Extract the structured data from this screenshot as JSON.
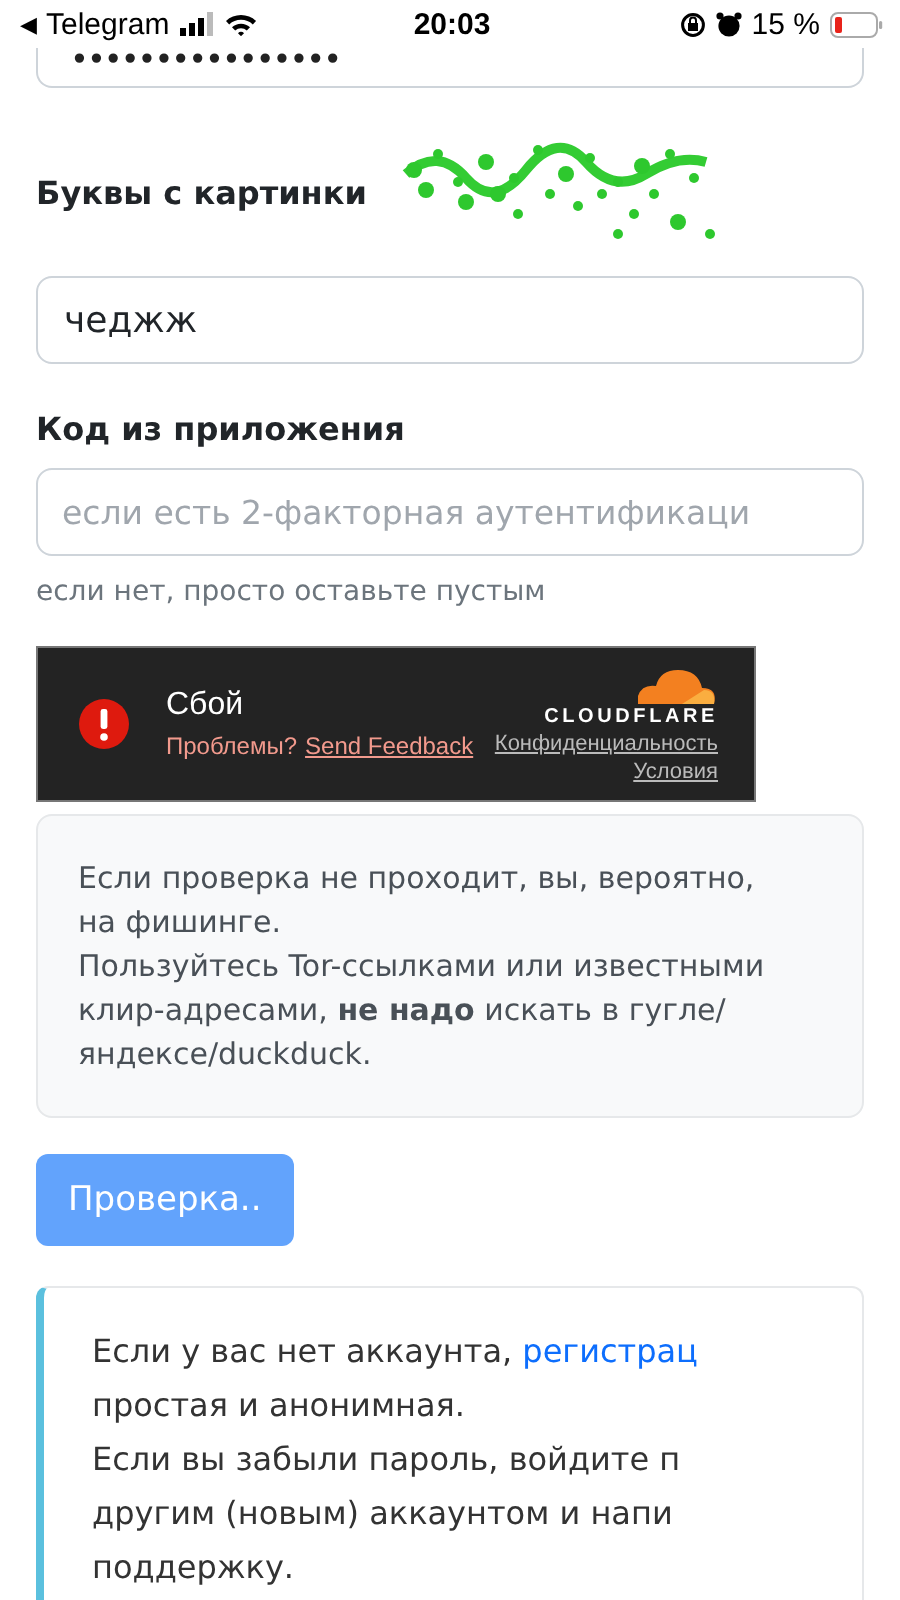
{
  "status_bar": {
    "back": "◀",
    "app": "Telegram",
    "time": "20:03",
    "battery": "15 %"
  },
  "password": {
    "value": "••••••••••••••••"
  },
  "captcha": {
    "label": "Буквы с картинки",
    "value": "чеджж"
  },
  "code": {
    "label": "Код из приложения",
    "placeholder": "если есть 2-факторная аутентификаци",
    "hint": "если нет, просто оставьте пустым"
  },
  "cloudflare": {
    "status": "Сбой",
    "problem": "Проблемы?",
    "feedback": "Send Feedback",
    "logo": "CLOUDFLARE",
    "privacy": "Конфиденциальность",
    "terms": "Условия"
  },
  "warning": {
    "paragraphs": [
      "Если проверка не проходит, вы, вероятно, на фишинге.",
      "Пользуйтесь Tor-ссылками или известными клир-адресами, **не надо** искать в гугле/ яндексе/duckduck."
    ]
  },
  "submit": {
    "label": "Проверка..",
    "disabled": true
  },
  "info": {
    "lines": [
      {
        "text": "Если у вас нет аккаунта, ",
        "link": "регистрац"
      },
      {
        "text": "простая и анонимная."
      },
      {
        "text": "Если вы забыли пароль, войдите п"
      },
      {
        "text": "другим (новым) аккаунтом и напи"
      },
      {
        "text": "поддержку."
      }
    ]
  }
}
